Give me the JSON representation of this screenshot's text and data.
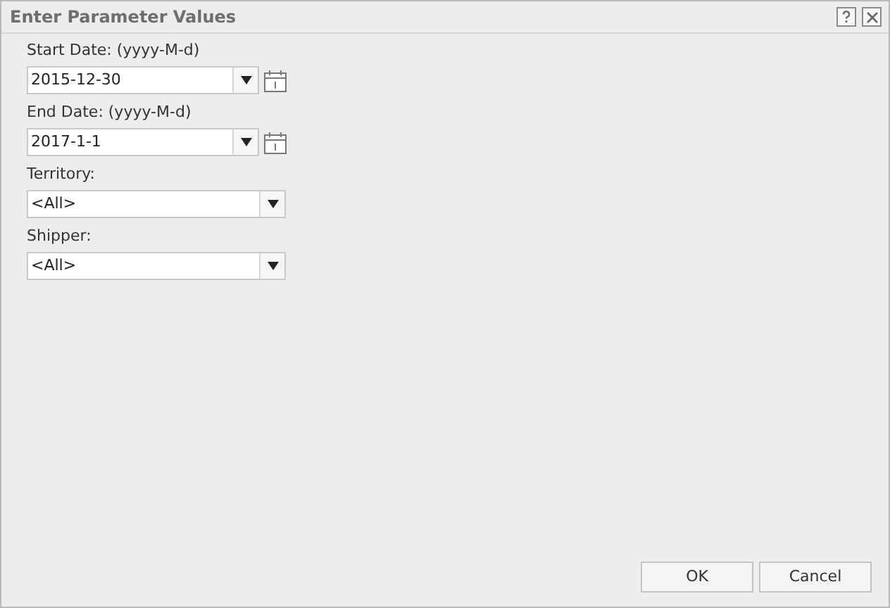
{
  "window": {
    "title": "Enter Parameter Values"
  },
  "parameters": [
    {
      "kind": "date",
      "label": "Start Date: (yyyy-M-d)",
      "value": "2015-12-30"
    },
    {
      "kind": "date",
      "label": "End Date: (yyyy-M-d)",
      "value": "2017-1-1"
    },
    {
      "kind": "select",
      "label": "Territory:",
      "value": "<All>"
    },
    {
      "kind": "select",
      "label": "Shipper:",
      "value": "<All>"
    }
  ],
  "buttons": [
    "OK",
    "Cancel"
  ]
}
